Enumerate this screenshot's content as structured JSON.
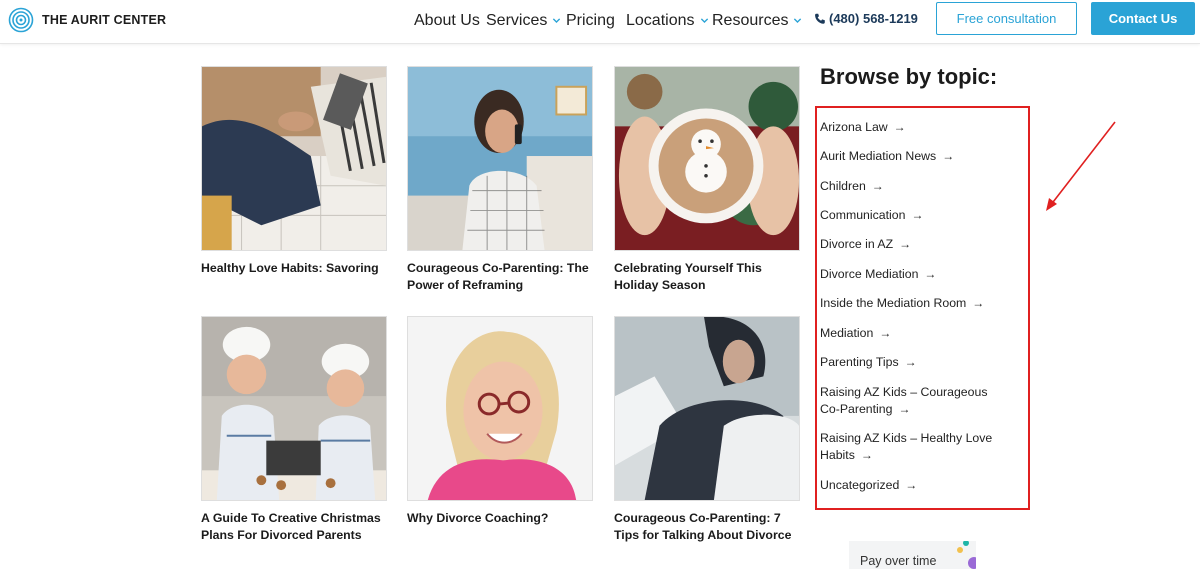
{
  "header": {
    "brand": "THE AURIT CENTER",
    "nav": [
      {
        "label": "About Us",
        "has_dropdown": false
      },
      {
        "label": "Services",
        "has_dropdown": true
      },
      {
        "label": "Pricing",
        "has_dropdown": false
      },
      {
        "label": "Locations",
        "has_dropdown": true
      },
      {
        "label": "Resources",
        "has_dropdown": true
      }
    ],
    "phone": "(480) 568-1219",
    "cta_outline": "Free consultation",
    "cta_solid": "Contact Us"
  },
  "posts": [
    {
      "title": "Healthy Love Habits: Savoring"
    },
    {
      "title": "Courageous Co-Parenting: The Power of Reframing"
    },
    {
      "title": "Celebrating Yourself This Holiday Season"
    },
    {
      "title": "A Guide To Creative Christmas Plans For Divorced Parents"
    },
    {
      "title": "Why Divorce Coaching?"
    },
    {
      "title": "Courageous Co-Parenting: 7 Tips for Talking About Divorce"
    }
  ],
  "sidebar": {
    "heading": "Browse by topic:",
    "arrow_glyph": "→",
    "topics": [
      "Arizona Law",
      "Aurit Mediation News",
      "Children",
      "Communication",
      "Divorce in AZ",
      "Divorce Mediation",
      "Inside the Mediation Room",
      "Mediation",
      "Parenting Tips",
      "Raising AZ Kids – Courageous Co-Parenting",
      "Raising AZ Kids – Healthy Love Habits",
      "Uncategorized"
    ]
  },
  "promo": {
    "text": "Pay over time"
  },
  "colors": {
    "accent": "#2aa3d6",
    "highlight": "#e02020",
    "phone": "#1c3a5a"
  }
}
